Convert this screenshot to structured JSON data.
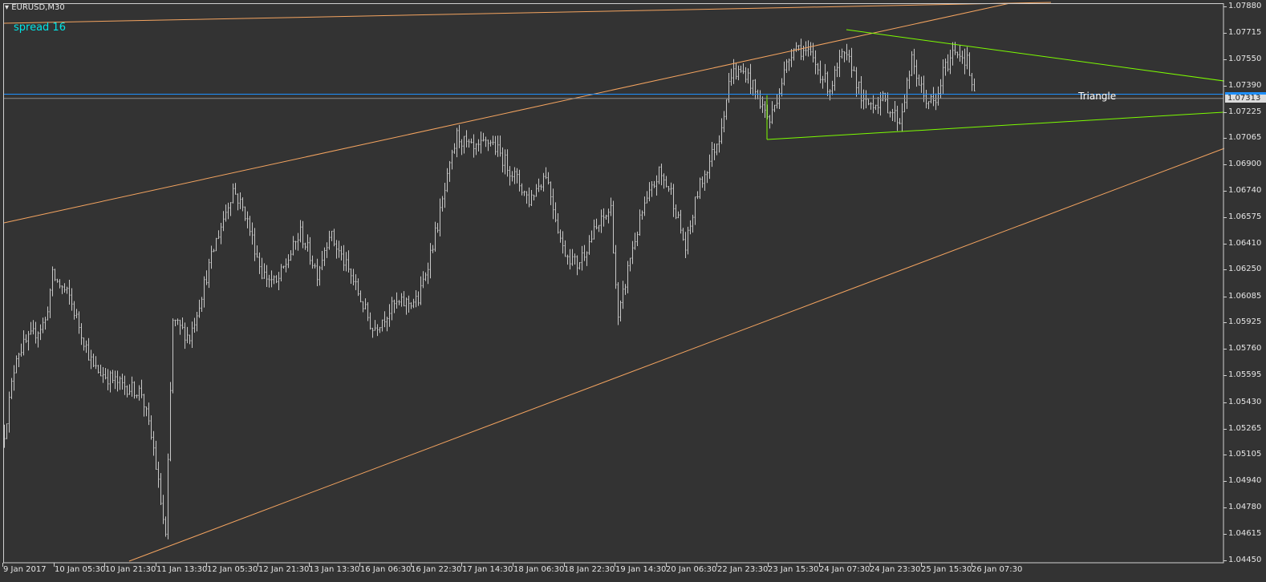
{
  "header": {
    "symbol_title": "EURUSD,M30",
    "spread_label": "spread 16"
  },
  "colors": {
    "background": "#333333",
    "bars": "#c8c8c8",
    "channel": "#f4a460",
    "triangle": "#7cfc00",
    "ask_line": "#1e90ff",
    "bid_line": "#8c8c8c",
    "spread_text": "#00e6e6"
  },
  "chart_data": {
    "type": "ohlc",
    "title": "EURUSD,M30",
    "ylim": [
      1.0445,
      1.0788
    ],
    "y_ticks": [
      "1.07880",
      "1.07715",
      "1.07550",
      "1.07390",
      "1.07225",
      "1.07065",
      "1.06900",
      "1.06740",
      "1.06575",
      "1.06410",
      "1.06250",
      "1.06085",
      "1.05925",
      "1.05760",
      "1.05595",
      "1.05430",
      "1.05265",
      "1.05105",
      "1.04940",
      "1.04780",
      "1.04615",
      "1.04450"
    ],
    "x_ticks": [
      "9 Jan 2017",
      "10 Jan 05:30",
      "10 Jan 21:30",
      "11 Jan 13:30",
      "12 Jan 05:30",
      "12 Jan 21:30",
      "13 Jan 13:30",
      "16 Jan 06:30",
      "16 Jan 22:30",
      "17 Jan 14:30",
      "18 Jan 06:30",
      "18 Jan 22:30",
      "19 Jan 14:30",
      "20 Jan 06:30",
      "22 Jan 23:30",
      "23 Jan 15:30",
      "24 Jan 07:30",
      "24 Jan 23:30",
      "25 Jan 15:30",
      "26 Jan 07:30"
    ],
    "bar_count": 404,
    "close_path": [
      [
        0,
        1.0524
      ],
      [
        5,
        1.0573
      ],
      [
        17,
        1.0593
      ],
      [
        20,
        1.0621
      ],
      [
        27,
        1.0608
      ],
      [
        37,
        1.0564
      ],
      [
        48,
        1.0554
      ],
      [
        57,
        1.0549
      ],
      [
        62,
        1.0514
      ],
      [
        67,
        1.0459
      ],
      [
        70,
        1.0593
      ],
      [
        77,
        1.0583
      ],
      [
        88,
        1.0643
      ],
      [
        95,
        1.0675
      ],
      [
        100,
        1.066
      ],
      [
        107,
        1.0623
      ],
      [
        113,
        1.0616
      ],
      [
        123,
        1.0648
      ],
      [
        130,
        1.0623
      ],
      [
        135,
        1.0648
      ],
      [
        145,
        1.0618
      ],
      [
        153,
        1.0588
      ],
      [
        162,
        1.0603
      ],
      [
        172,
        1.0606
      ],
      [
        180,
        1.0653
      ],
      [
        188,
        1.0708
      ],
      [
        195,
        1.0698
      ],
      [
        202,
        1.0705
      ],
      [
        212,
        1.0683
      ],
      [
        218,
        1.0668
      ],
      [
        225,
        1.0685
      ],
      [
        232,
        1.0638
      ],
      [
        238,
        1.0628
      ],
      [
        245,
        1.0648
      ],
      [
        252,
        1.0663
      ],
      [
        255,
        1.0593
      ],
      [
        260,
        1.0633
      ],
      [
        265,
        1.066
      ],
      [
        272,
        1.0685
      ],
      [
        277,
        1.0673
      ],
      [
        283,
        1.0638
      ],
      [
        288,
        1.0673
      ],
      [
        297,
        1.0708
      ],
      [
        302,
        1.0747
      ],
      [
        308,
        1.0747
      ],
      [
        313,
        1.0732
      ],
      [
        318,
        1.0717
      ],
      [
        323,
        1.0742
      ],
      [
        328,
        1.0765
      ],
      [
        335,
        1.0757
      ],
      [
        343,
        1.0737
      ],
      [
        348,
        1.0757
      ],
      [
        352,
        1.0752
      ],
      [
        357,
        1.0727
      ],
      [
        365,
        1.073
      ],
      [
        372,
        1.0717
      ],
      [
        377,
        1.0754
      ],
      [
        382,
        1.0732
      ],
      [
        387,
        1.0727
      ],
      [
        390,
        1.0747
      ],
      [
        395,
        1.0762
      ],
      [
        400,
        1.0754
      ],
      [
        403,
        1.0732
      ]
    ],
    "trendlines": [
      {
        "name": "channel-top-line",
        "kind": "channel",
        "from": [
          0,
          1.07776
        ],
        "to": [
          435,
          1.07905
        ]
      },
      {
        "name": "channel-upper-line",
        "kind": "channel",
        "from": [
          0,
          1.0654
        ],
        "to": [
          418,
          1.079
        ]
      },
      {
        "name": "channel-lower-line",
        "kind": "channel",
        "from": [
          52,
          1.04445
        ],
        "to": [
          507,
          1.07001
        ]
      },
      {
        "name": "triangle-upper-line",
        "kind": "triangle",
        "from": [
          350,
          1.07736
        ],
        "to": [
          507,
          1.07418
        ]
      },
      {
        "name": "triangle-lower-line",
        "kind": "triangle",
        "from": [
          317,
          1.07056
        ],
        "to": [
          507,
          1.07225
        ]
      }
    ],
    "ask_price": 1.07339,
    "bid_price": "1.07313",
    "annotation": "Triangle"
  }
}
